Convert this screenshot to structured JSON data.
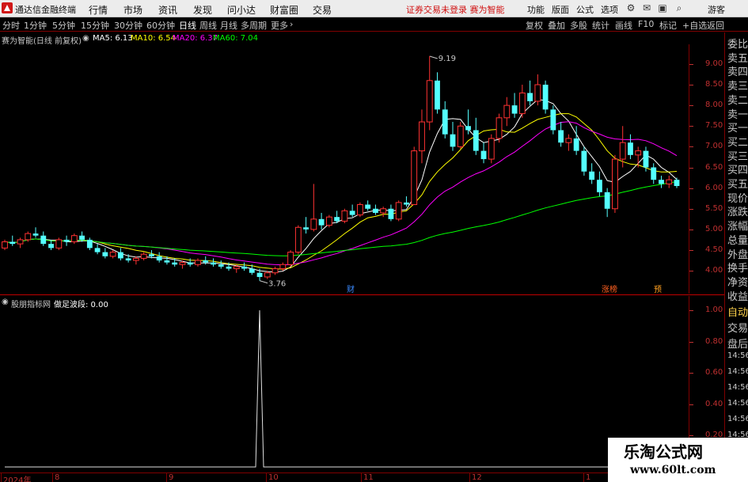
{
  "titlebar": {
    "app_name": "通达信金融终端",
    "menus": [
      "行情",
      "市场",
      "资讯",
      "发现",
      "问小达",
      "财富圈",
      "交易"
    ],
    "warning": "证券交易未登录  赛为智能",
    "right_menus": [
      "功能",
      "版面",
      "公式",
      "选项"
    ],
    "guest": "游客"
  },
  "toolbar": {
    "periods": [
      "分时",
      "1分钟",
      "5分钟",
      "15分钟",
      "30分钟",
      "60分钟",
      "日线",
      "周线",
      "月线",
      "多周期",
      "更多"
    ],
    "active_period": "日线",
    "right_buttons": [
      "复权",
      "叠加",
      "多股",
      "统计",
      "画线",
      "F10",
      "标记",
      "+自选",
      "返回"
    ]
  },
  "ma_line": {
    "stock": "赛为智能(日线 前复权)",
    "ma5": "MA5: 6.13",
    "ma10": "MA10: 6.54",
    "ma20": "MA20: 6.37",
    "ma60": "MA60: 7.04"
  },
  "colors": {
    "up": "#ff3232",
    "down": "#54ffff",
    "ma5": "#ffffff",
    "ma10": "#ffff00",
    "ma20": "#ff00ff",
    "ma60": "#00ff00",
    "axis": "#c03030"
  },
  "price_axis": [
    "9.00",
    "8.50",
    "8.00",
    "7.50",
    "7.00",
    "6.50",
    "6.00",
    "5.50",
    "5.00",
    "4.50",
    "4.00"
  ],
  "annotations": {
    "high": "9.19",
    "low": "3.76",
    "cai": "财",
    "zhangting": "涨榜",
    "yu": "预"
  },
  "sub_indicator": {
    "name": "股朋指标网",
    "label": "做足波段: 0.00",
    "axis": [
      "1.00",
      "0.80",
      "0.60",
      "0.40",
      "0.20"
    ]
  },
  "side_panel": {
    "items": [
      "委比",
      "卖五",
      "卖四",
      "卖三",
      "卖二",
      "卖一",
      "买一",
      "买二",
      "买三",
      "买四",
      "买五",
      "现价",
      "涨跌",
      "涨幅",
      "总量",
      "外盘",
      "换手",
      "净资",
      "收益"
    ],
    "lower_items": [
      "自动",
      "交易",
      "盘后",
      "14:56",
      "14:56",
      "14:56",
      "14:56",
      "14:56",
      "14:56",
      "14:56",
      "14:56"
    ]
  },
  "date_axis": [
    "2024年",
    "8",
    "9",
    "10",
    "11",
    "12",
    "1"
  ],
  "watermark": {
    "title": "乐淘公式网",
    "url": "www.60lt.com"
  },
  "chart_data": {
    "type": "candlestick",
    "ylim": [
      3.6,
      9.4
    ],
    "candles": [
      [
        4.55,
        4.75,
        4.5,
        4.7
      ],
      [
        4.7,
        4.85,
        4.6,
        4.65
      ],
      [
        4.65,
        4.8,
        4.55,
        4.75
      ],
      [
        4.75,
        4.95,
        4.7,
        4.9
      ],
      [
        4.9,
        5.05,
        4.8,
        4.85
      ],
      [
        4.85,
        4.95,
        4.6,
        4.65
      ],
      [
        4.65,
        4.75,
        4.5,
        4.55
      ],
      [
        4.55,
        4.8,
        4.5,
        4.75
      ],
      [
        4.75,
        4.85,
        4.6,
        4.7
      ],
      [
        4.7,
        4.9,
        4.65,
        4.85
      ],
      [
        4.85,
        4.95,
        4.7,
        4.75
      ],
      [
        4.75,
        4.8,
        4.5,
        4.55
      ],
      [
        4.55,
        4.65,
        4.4,
        4.45
      ],
      [
        4.45,
        4.55,
        4.3,
        4.35
      ],
      [
        4.35,
        4.5,
        4.3,
        4.45
      ],
      [
        4.45,
        4.55,
        4.25,
        4.3
      ],
      [
        4.3,
        4.4,
        4.2,
        4.25
      ],
      [
        4.25,
        4.35,
        4.15,
        4.3
      ],
      [
        4.3,
        4.45,
        4.25,
        4.4
      ],
      [
        4.4,
        4.5,
        4.3,
        4.35
      ],
      [
        4.35,
        4.45,
        4.2,
        4.25
      ],
      [
        4.25,
        4.35,
        4.15,
        4.2
      ],
      [
        4.2,
        4.3,
        4.1,
        4.15
      ],
      [
        4.15,
        4.25,
        4.05,
        4.2
      ],
      [
        4.2,
        4.3,
        4.1,
        4.15
      ],
      [
        4.15,
        4.3,
        4.1,
        4.25
      ],
      [
        4.25,
        4.35,
        4.15,
        4.2
      ],
      [
        4.2,
        4.3,
        4.1,
        4.15
      ],
      [
        4.15,
        4.25,
        4.05,
        4.1
      ],
      [
        4.1,
        4.2,
        4.0,
        4.05
      ],
      [
        4.05,
        4.15,
        3.95,
        4.1
      ],
      [
        4.1,
        4.2,
        4.0,
        4.05
      ],
      [
        4.05,
        4.15,
        3.9,
        3.95
      ],
      [
        3.95,
        4.05,
        3.76,
        3.85
      ],
      [
        3.85,
        4.0,
        3.8,
        3.95
      ],
      [
        3.95,
        4.1,
        3.9,
        4.05
      ],
      [
        4.05,
        4.2,
        4.0,
        4.15
      ],
      [
        4.15,
        4.5,
        4.1,
        4.45
      ],
      [
        4.45,
        5.1,
        4.4,
        5.05
      ],
      [
        5.05,
        5.3,
        4.9,
        5.0
      ],
      [
        5.0,
        6.1,
        4.95,
        5.25
      ],
      [
        5.25,
        5.4,
        5.0,
        5.1
      ],
      [
        5.1,
        5.35,
        5.05,
        5.3
      ],
      [
        5.3,
        5.45,
        5.15,
        5.2
      ],
      [
        5.2,
        5.5,
        5.15,
        5.45
      ],
      [
        5.45,
        5.6,
        5.3,
        5.35
      ],
      [
        5.35,
        5.65,
        5.3,
        5.6
      ],
      [
        5.6,
        5.7,
        5.45,
        5.5
      ],
      [
        5.5,
        5.6,
        5.35,
        5.4
      ],
      [
        5.4,
        5.55,
        5.3,
        5.5
      ],
      [
        5.5,
        5.6,
        5.2,
        5.25
      ],
      [
        5.25,
        5.7,
        5.2,
        5.65
      ],
      [
        5.65,
        5.8,
        5.55,
        5.6
      ],
      [
        5.6,
        7.0,
        5.6,
        6.9
      ],
      [
        6.9,
        7.9,
        6.6,
        7.6
      ],
      [
        7.6,
        9.19,
        7.4,
        8.6
      ],
      [
        8.6,
        8.8,
        7.8,
        7.9
      ],
      [
        7.9,
        8.1,
        7.2,
        7.3
      ],
      [
        7.3,
        7.6,
        6.9,
        7.0
      ],
      [
        7.0,
        7.6,
        6.95,
        7.5
      ],
      [
        7.5,
        7.9,
        7.3,
        7.4
      ],
      [
        7.4,
        7.7,
        6.8,
        6.9
      ],
      [
        6.9,
        7.1,
        6.6,
        6.7
      ],
      [
        6.7,
        7.3,
        6.6,
        7.2
      ],
      [
        7.2,
        7.8,
        7.1,
        7.7
      ],
      [
        7.7,
        8.2,
        7.5,
        8.0
      ],
      [
        8.0,
        8.3,
        7.7,
        7.8
      ],
      [
        7.8,
        8.5,
        7.7,
        8.3
      ],
      [
        8.3,
        8.6,
        8.0,
        8.1
      ],
      [
        8.1,
        8.75,
        8.0,
        8.5
      ],
      [
        8.5,
        8.6,
        7.8,
        7.9
      ],
      [
        7.9,
        8.0,
        7.3,
        7.4
      ],
      [
        7.4,
        7.6,
        7.0,
        7.1
      ],
      [
        7.1,
        7.3,
        6.9,
        7.2
      ],
      [
        7.2,
        7.5,
        6.8,
        6.9
      ],
      [
        6.9,
        7.0,
        6.3,
        6.4
      ],
      [
        6.4,
        6.6,
        6.1,
        6.2
      ],
      [
        6.2,
        6.4,
        5.8,
        5.9
      ],
      [
        5.9,
        6.0,
        5.3,
        5.5
      ],
      [
        5.5,
        6.8,
        5.4,
        6.7
      ],
      [
        6.7,
        7.5,
        6.5,
        7.1
      ],
      [
        7.1,
        7.3,
        6.7,
        6.8
      ],
      [
        6.8,
        7.0,
        6.5,
        6.9
      ],
      [
        6.9,
        7.0,
        6.4,
        6.5
      ],
      [
        6.5,
        6.6,
        6.1,
        6.2
      ],
      [
        6.2,
        6.3,
        6.0,
        6.1
      ],
      [
        6.1,
        6.3,
        6.0,
        6.2
      ],
      [
        6.2,
        6.25,
        6.0,
        6.05
      ]
    ],
    "sub_series": {
      "name": "做足波段",
      "spike_index": 33,
      "spike_value": 1.0
    }
  }
}
